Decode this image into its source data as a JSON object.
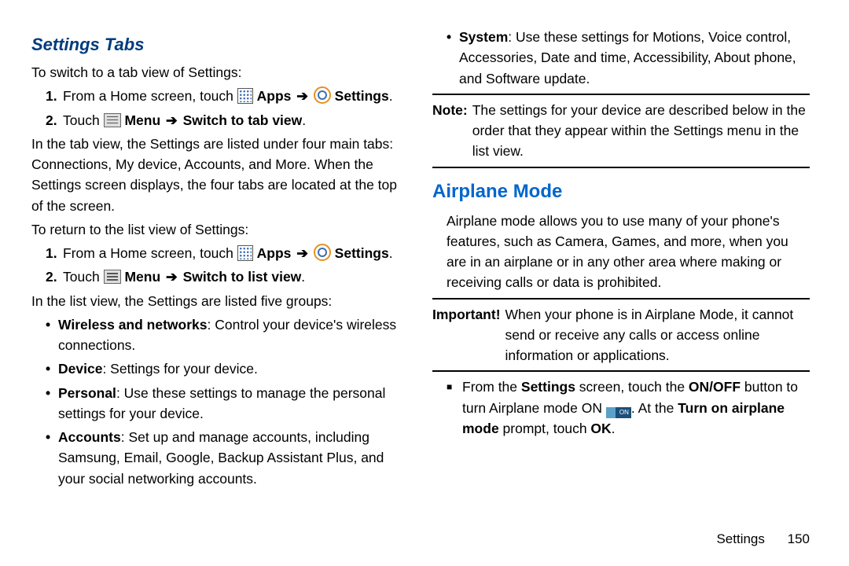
{
  "left": {
    "sectionTitle": "Settings Tabs",
    "intro1": "To switch to a tab view of Settings:",
    "step1_pre": "From a Home screen, touch ",
    "apps_label": "Apps",
    "settings_label": "Settings",
    "step2_pre": "Touch ",
    "menu_label": "Menu",
    "switch_tab": "Switch to tab view",
    "tabview_desc": "In the tab view, the Settings are listed under four main tabs: Connections, My device, Accounts, and More. When the Settings screen displays, the four tabs are located at the top of the screen.",
    "intro2": "To return to the list view of Settings:",
    "step1b_pre": "From a Home screen, touch ",
    "switch_list": "Switch to list view",
    "listview_intro": "In the list view, the Settings are listed five groups:",
    "bullets": [
      {
        "bold": "Wireless and networks",
        "rest": ": Control your device's wireless connections."
      },
      {
        "bold": "Device",
        "rest": ": Settings for your device."
      },
      {
        "bold": "Personal",
        "rest": ": Use these settings to manage the personal settings for your device."
      },
      {
        "bold": "Accounts",
        "rest": ": Set up and manage accounts, including Samsung, Email, Google, Backup Assistant Plus, and your social networking accounts."
      }
    ]
  },
  "right": {
    "system_bullet": {
      "bold": "System",
      "rest": ": Use these settings for Motions, Voice control, Accessories, Date and time, Accessibility, About phone, and Software update."
    },
    "note_label": "Note:",
    "note_text": "The settings for your device are described below in the order that they appear within the Settings menu in the list view.",
    "airplane_title": "Airplane Mode",
    "airplane_desc": "Airplane mode allows you to use many of your phone's features, such as Camera, Games, and more, when you are in an airplane or in any other area where making or receiving calls or data is prohibited.",
    "important_label": "Important!",
    "important_text": "When your phone is in Airplane Mode, it cannot send or receive any calls or access online information or applications.",
    "sq_pre": "From the ",
    "sq_settings": "Settings",
    "sq_mid1": " screen, touch the ",
    "sq_onoff": "ON/OFF",
    "sq_mid2": " button to turn Airplane mode ON ",
    "on_text": "ON",
    "sq_mid3": ". At the ",
    "sq_turn_on": "Turn on airplane mode",
    "sq_mid4": " prompt, touch ",
    "sq_ok": "OK",
    "sq_end": "."
  },
  "footer": {
    "section": "Settings",
    "page": "150"
  },
  "arrow": "➔",
  "dot": "•",
  "square": "■",
  "period": "."
}
